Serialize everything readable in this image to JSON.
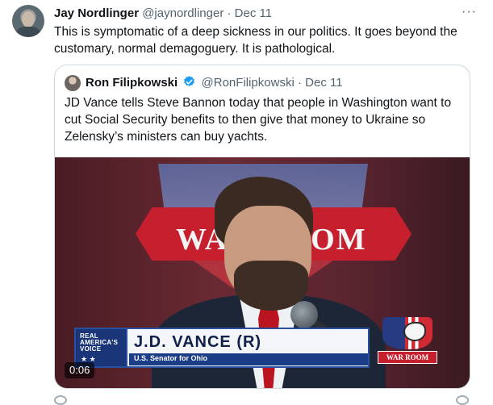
{
  "tweet": {
    "author_name": "Jay Nordlinger",
    "author_handle": "@jaynordlinger",
    "separator": "·",
    "date": "Dec 11",
    "more": "···",
    "text": "This is symptomatic of a deep sickness in our politics. It goes beyond the customary, normal demagoguery. It is pathological."
  },
  "quote": {
    "author_name": "Ron Filipkowski",
    "author_handle": "@RonFilipkowski",
    "separator": "·",
    "date": "Dec 11",
    "text": "JD Vance tells Steve Bannon today that people in Washington want to cut Social Security benefits to then give that money to Ukraine so Zelensky’s ministers can buy yachts."
  },
  "video": {
    "backdrop_text": "WAR ROOM",
    "network_label": "REAL AMERICA'S VOICE",
    "network_stars": "★          ★",
    "lower_third_name": "J.D. VANCE (R)",
    "lower_third_title": "U.S. Senator for Ohio",
    "logo_text": "WAR ROOM",
    "timestamp": "0:06"
  },
  "colors": {
    "verified": "#1d9bf0",
    "muted": "#536471",
    "border": "#cfd9de"
  }
}
